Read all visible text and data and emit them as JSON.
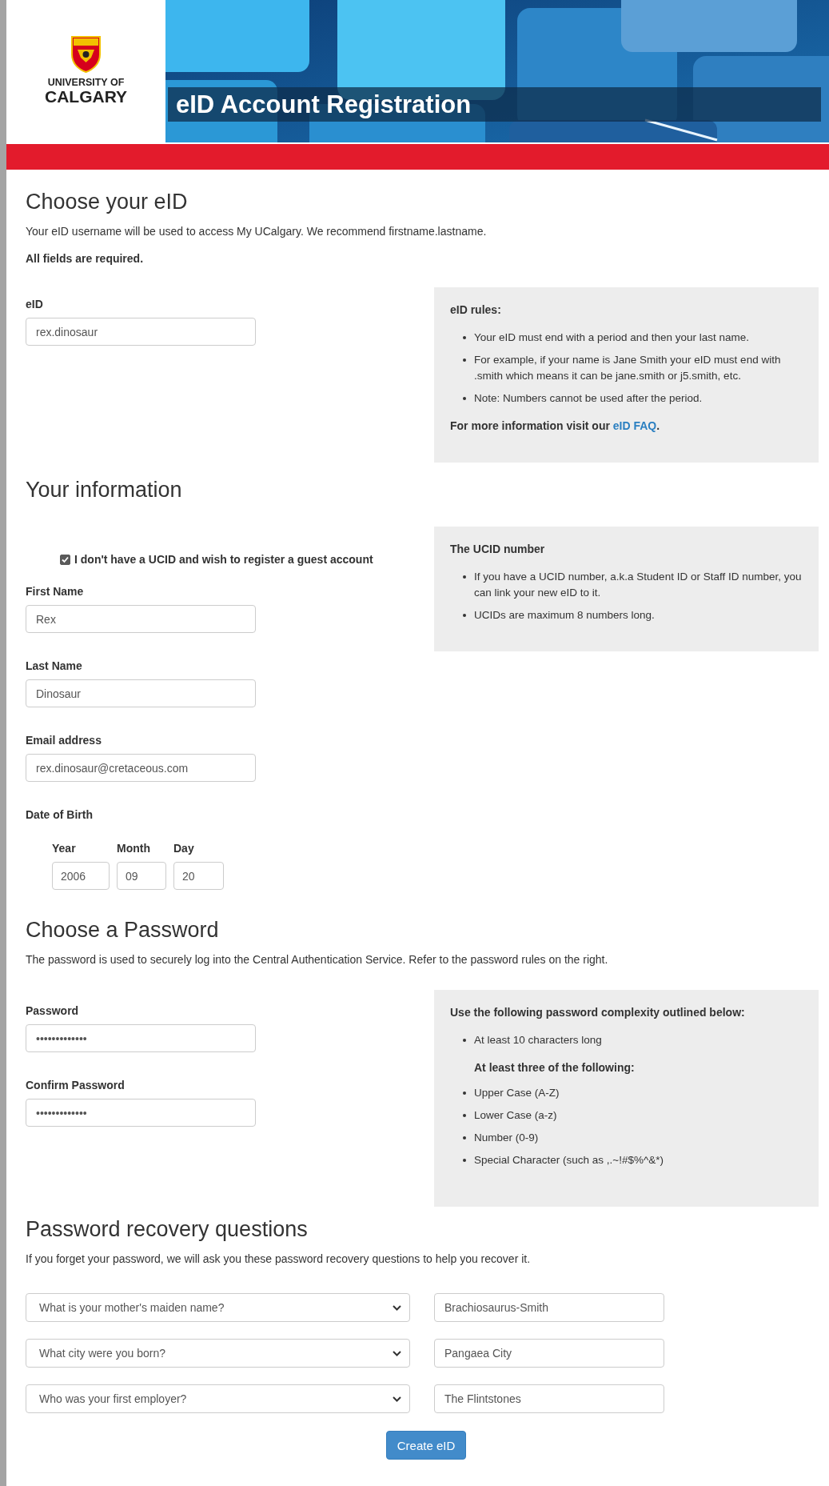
{
  "header": {
    "logo": {
      "line1": "UNIVERSITY OF",
      "line2": "CALGARY"
    },
    "title": "eID Account Registration"
  },
  "sections": [
    {
      "heading": "Choose your eID",
      "intro": "Your eID username will be used to access My UCalgary. We recommend firstname.lastname.",
      "note": "All fields are required.",
      "fields": [
        {
          "label": "eID",
          "value": "rex.dinosaur"
        }
      ],
      "panel": {
        "title": "eID rules:",
        "items": [
          {
            "kind": "bullet",
            "text": "Your eID must end with a period and then your last name."
          },
          {
            "kind": "bullet",
            "text": "For example, if your name is Jane Smith your eID must end with .smith which means it can be jane.smith or j5.smith, etc."
          },
          {
            "kind": "bullet",
            "text": "Note: Numbers cannot be used after the period."
          }
        ],
        "footer": {
          "text": "For more information visit our ",
          "link": "eID FAQ",
          "end": "."
        }
      }
    },
    {
      "heading": "Your information",
      "guest_checkbox": {
        "label": "I don't have a UCID and wish to register a guest account",
        "checked": true
      },
      "fields": [
        {
          "label": "First Name",
          "value": "Rex"
        },
        {
          "label": "Last Name",
          "value": "Dinosaur"
        },
        {
          "label": "Email address",
          "value": "rex.dinosaur@cretaceous.com"
        }
      ],
      "date_of_birth": {
        "label": "Date of Birth",
        "parts": [
          {
            "label": "Year",
            "value": "2006"
          },
          {
            "label": "Month",
            "value": "09"
          },
          {
            "label": "Day",
            "value": "20"
          }
        ]
      },
      "panel": {
        "title": "The UCID number",
        "items": [
          {
            "kind": "bullet",
            "text": "If you have a UCID number, a.k.a Student ID or Staff ID number, you can link your new eID to it."
          },
          {
            "kind": "bullet",
            "text": "UCIDs are maximum 8 numbers long."
          }
        ]
      }
    },
    {
      "heading": "Choose a Password",
      "intro": "The password is used to securely log into the Central Authentication Service. Refer to the password rules on the right.",
      "fields": [
        {
          "label": "Password",
          "value": "•••••••••••••"
        },
        {
          "label": "Confirm Password",
          "value": "•••••••••••••"
        }
      ],
      "panel": {
        "title": "Use the following password complexity outlined below:",
        "items": [
          {
            "kind": "bullet",
            "text": "At least 10 characters long"
          },
          {
            "kind": "subheading",
            "text": "At least three of the following:"
          },
          {
            "kind": "bullet",
            "text": "Upper Case (A-Z)"
          },
          {
            "kind": "bullet",
            "text": "Lower Case (a-z)"
          },
          {
            "kind": "bullet",
            "text": "Number (0-9)"
          },
          {
            "kind": "bullet",
            "text": "Special Character (such as ,.~!#$%^&*)"
          }
        ]
      }
    },
    {
      "heading": "Password recovery questions",
      "intro": "If you forget your password, we will ask you these password recovery questions to help you recover it.",
      "questions": [
        {
          "question": "What is your mother's maiden name?",
          "answer": "Brachiosaurus-Smith"
        },
        {
          "question": "What city were you born?",
          "answer": "Pangaea City"
        },
        {
          "question": "Who was your first employer?",
          "answer": "The Flintstones"
        }
      ]
    }
  ],
  "submit": {
    "label": "Create eID"
  }
}
